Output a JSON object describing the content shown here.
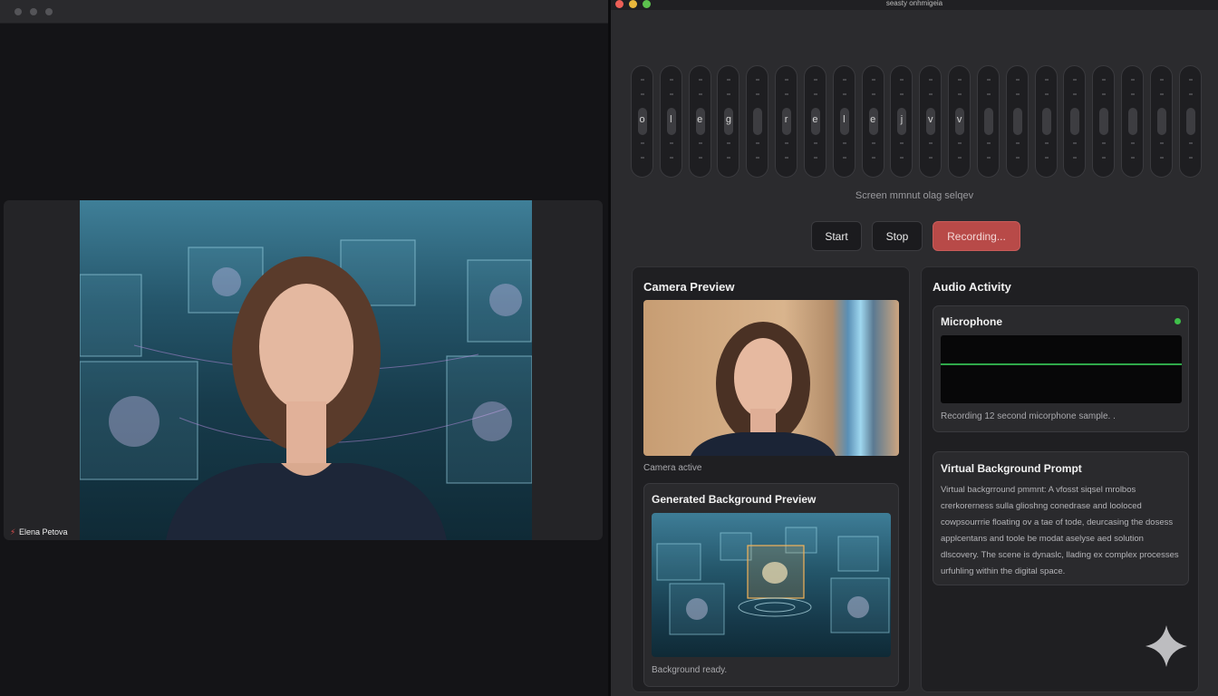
{
  "left_window": {
    "participant_name": "Elena Petova"
  },
  "right_window": {
    "title": "seasty onhmigeia",
    "sliders": [
      {
        "glyph": "o"
      },
      {
        "glyph": "l"
      },
      {
        "glyph": "e"
      },
      {
        "glyph": "g"
      },
      {
        "glyph": ""
      },
      {
        "glyph": "r"
      },
      {
        "glyph": "e"
      },
      {
        "glyph": "l"
      },
      {
        "glyph": "e"
      },
      {
        "glyph": "j"
      },
      {
        "glyph": "v"
      },
      {
        "glyph": "v"
      },
      {
        "glyph": ""
      },
      {
        "glyph": ""
      },
      {
        "glyph": ""
      },
      {
        "glyph": ""
      },
      {
        "glyph": ""
      },
      {
        "glyph": ""
      },
      {
        "glyph": ""
      },
      {
        "glyph": ""
      }
    ],
    "screen_status": "Screen mmnut olag selqev",
    "buttons": {
      "start": "Start",
      "stop": "Stop",
      "recording": "Recording..."
    },
    "camera_card": {
      "title": "Camera Preview",
      "caption": "Camera active",
      "generated": {
        "title": "Generated Background Preview",
        "caption": "Background ready."
      }
    },
    "audio_card": {
      "title": "Audio Activity",
      "microphone": {
        "title": "Microphone",
        "status": "Recording 12 second micorphone sample. ."
      },
      "prompt": {
        "title": "Virtual Background Prompt",
        "text": "Virtual backgrround pmmnt: A vfosst siqsel mrolbos crerkorerness sulla glioshng conedrase and looloced cowpsourrrie floating ov a tae of tode, deurcasing the dosess applcentans and toole be modat aselyse aed solution dlscovery. The scene is dynaslc, llading ex complex processes urfuhling within the digital space."
      }
    }
  },
  "colors": {
    "recording_button": "#b84a48",
    "mic_led": "#3fbf4a",
    "waveform_line": "#2fa84a"
  },
  "icons": [
    "sparkle-icon",
    "participant-icon"
  ]
}
